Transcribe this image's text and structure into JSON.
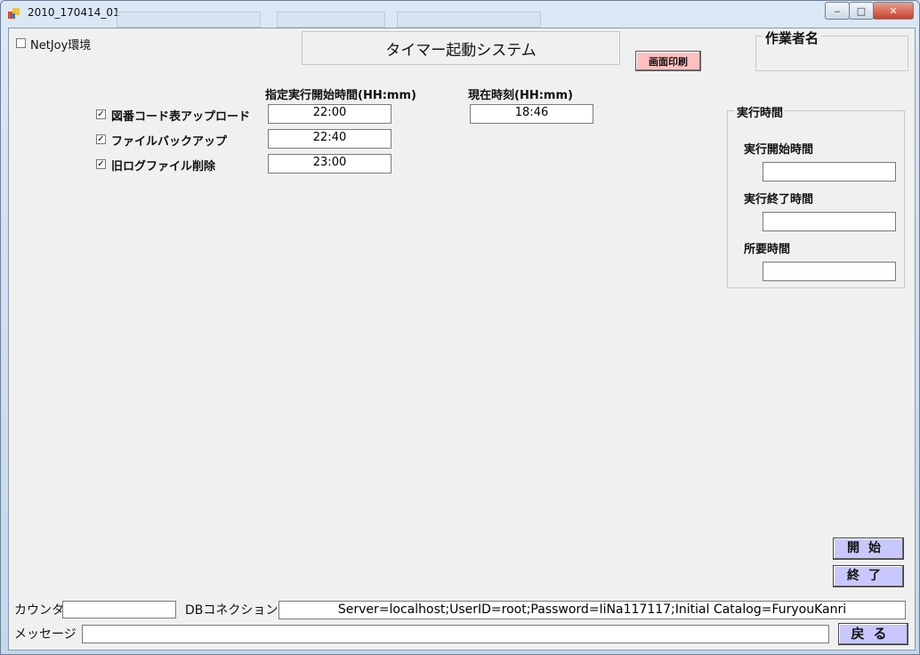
{
  "window": {
    "title": "2010_170414_01"
  },
  "titlebar_controls": {
    "minimize": "‒",
    "maximize": "□",
    "close": "✕"
  },
  "netjoy": {
    "label": "NetJoy環境",
    "checked": false
  },
  "header": {
    "title": "タイマー起動システム",
    "print_button": "画面印刷"
  },
  "operator": {
    "legend": "作業者名"
  },
  "columns": {
    "start_time_header": "指定実行開始時間(HH:mm)",
    "current_time_header": "現在時刻(HH:mm)"
  },
  "tasks": [
    {
      "label": "図番コード表アップロード",
      "checked": true,
      "time": "22:00"
    },
    {
      "label": "ファイルバックアップ",
      "checked": true,
      "time": "22:40"
    },
    {
      "label": "旧ログファイル削除",
      "checked": true,
      "time": "23:00"
    }
  ],
  "current_time": "18:46",
  "exec_time": {
    "legend": "実行時間",
    "start_label": "実行開始時間",
    "end_label": "実行終了時間",
    "duration_label": "所要時間",
    "start_value": "",
    "end_value": "",
    "duration_value": ""
  },
  "buttons": {
    "start": "開始",
    "end": "終了",
    "back": "戻る"
  },
  "footer": {
    "counter_label": "カウンタ",
    "counter_value": "",
    "db_label": "DBコネクション",
    "db_value": "Server=localhost;UserID=root;Password=IiNa117117;Initial Catalog=FuryouKanri",
    "message_label": "メッセージ",
    "message_value": ""
  }
}
